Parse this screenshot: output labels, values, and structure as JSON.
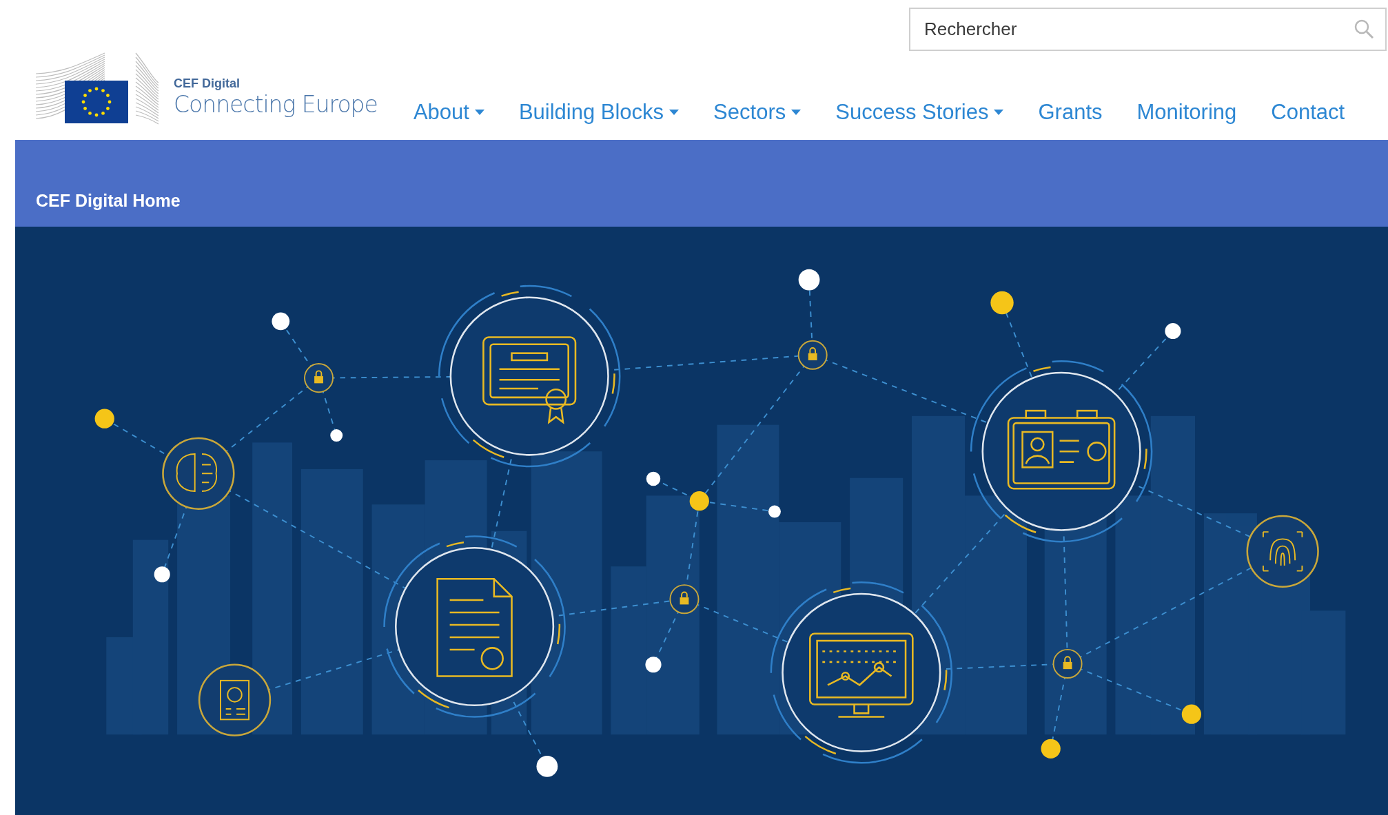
{
  "search": {
    "placeholder": "Rechercher"
  },
  "logo": {
    "kicker": "CEF Digital",
    "title": "Connecting Europe"
  },
  "nav": [
    {
      "label": "About",
      "has_menu": true
    },
    {
      "label": "Building Blocks",
      "has_menu": true
    },
    {
      "label": "Sectors",
      "has_menu": true
    },
    {
      "label": "Success Stories",
      "has_menu": true
    },
    {
      "label": "Grants",
      "has_menu": false
    },
    {
      "label": "Monitoring",
      "has_menu": false
    },
    {
      "label": "Contact",
      "has_menu": false
    }
  ],
  "breadcrumb": "CEF Digital Home"
}
